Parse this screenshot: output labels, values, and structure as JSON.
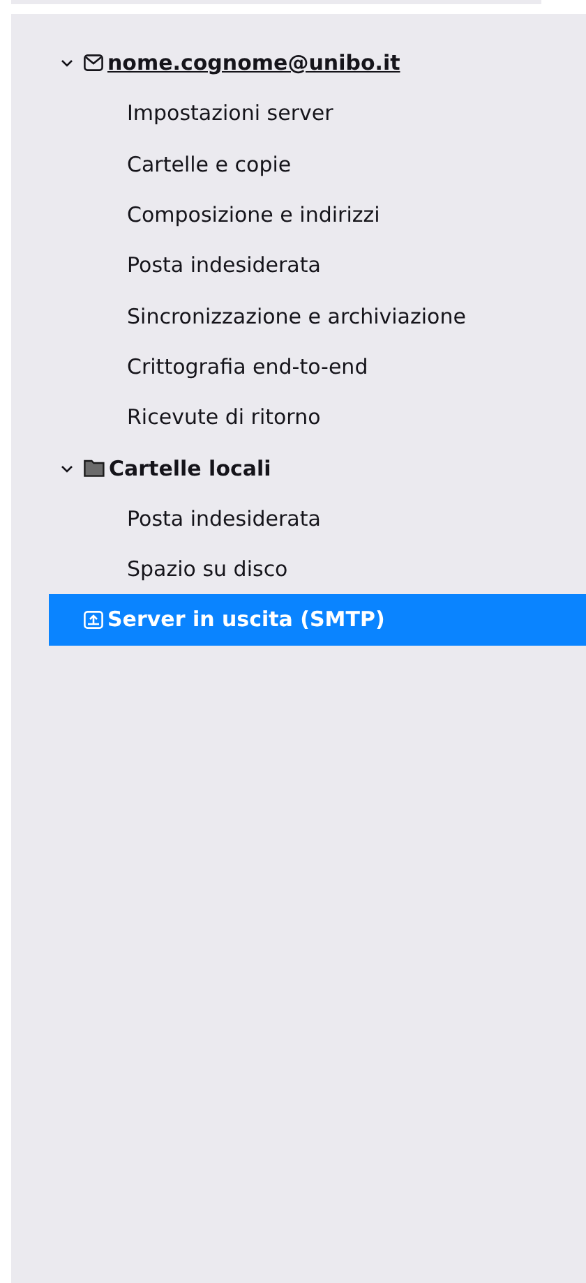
{
  "tree": [
    {
      "label": "nome.cognome@unibo.it",
      "kind": "account",
      "expanded": true,
      "selected": false,
      "focused": true,
      "children": [
        {
          "label": "Impostazioni server",
          "selected": false
        },
        {
          "label": "Cartelle e copie",
          "selected": false
        },
        {
          "label": "Composizione e indirizzi",
          "selected": false
        },
        {
          "label": "Posta indesiderata",
          "selected": false
        },
        {
          "label": "Sincronizzazione e archiviazione",
          "selected": false
        },
        {
          "label": "Crittografia end-to-end",
          "selected": false
        },
        {
          "label": "Ricevute di ritorno",
          "selected": false
        }
      ]
    },
    {
      "label": "Cartelle locali",
      "kind": "folder",
      "expanded": true,
      "selected": false,
      "focused": false,
      "children": [
        {
          "label": "Posta indesiderata",
          "selected": false
        },
        {
          "label": "Spazio su disco",
          "selected": false
        }
      ]
    },
    {
      "label": "Server in uscita (SMTP)",
      "kind": "outgoing",
      "selected": true,
      "focused": false
    }
  ]
}
